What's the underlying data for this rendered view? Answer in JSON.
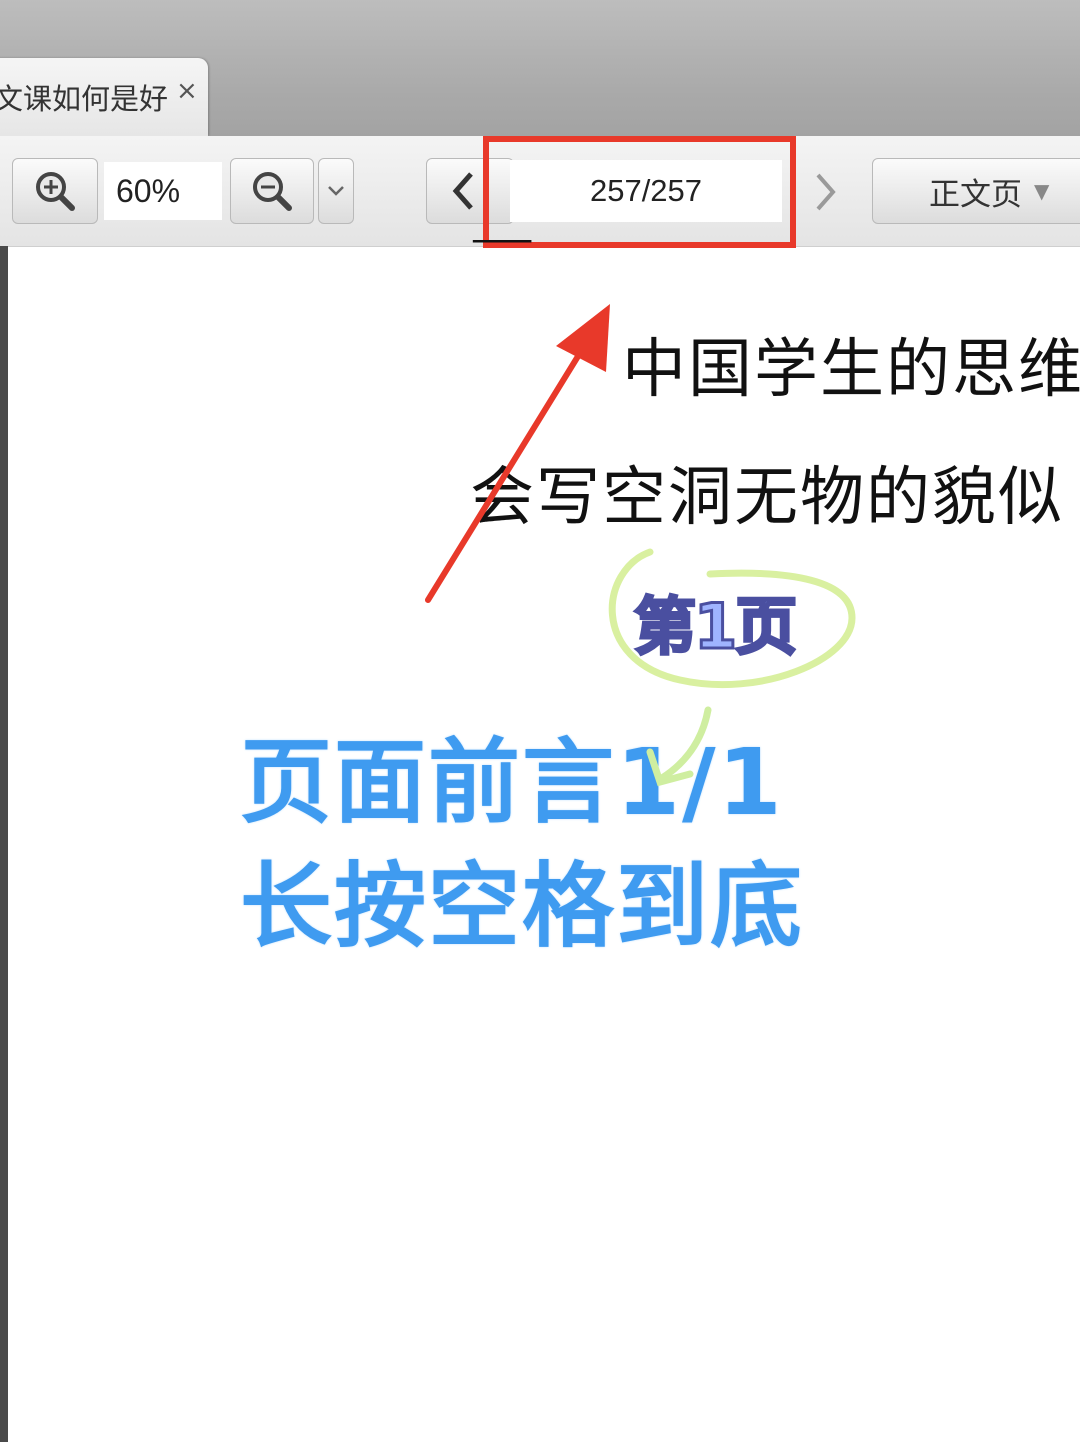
{
  "tab": {
    "title": "文课如何是好",
    "close": "×"
  },
  "toolbar": {
    "zoom_value": "60%",
    "page_indicator": "257/257",
    "section_label": "正文页"
  },
  "document": {
    "line_1": "中国学生的思维",
    "line_2": "会写空洞无物的貌似"
  },
  "annotation": {
    "sticker": "第1页",
    "line_1": "页面前言1/1",
    "line_2": "长按空格到底"
  },
  "colors": {
    "highlight": "#e8392a",
    "arrow": "#e8392a",
    "annotation_text": "#3f9bf0",
    "sticker_ring": "#d9f0a0"
  }
}
